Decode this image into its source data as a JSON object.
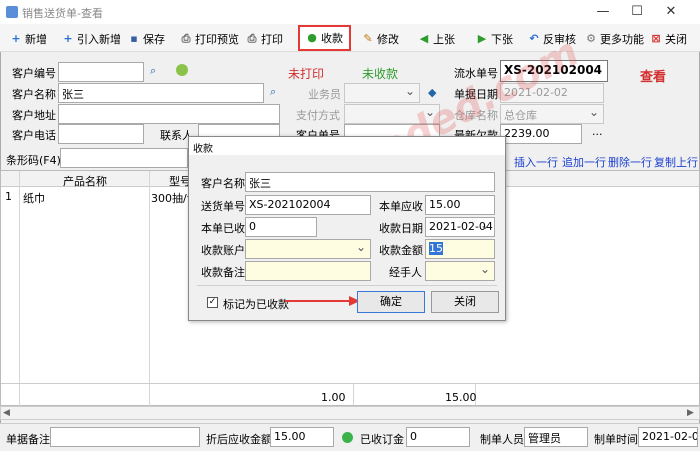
{
  "window": {
    "title": "销售送货单-查看",
    "min": "—",
    "max": "☐",
    "close": "✕"
  },
  "toolbar": {
    "new": "新增",
    "import_new": "引入新增",
    "save": "保存",
    "print_preview": "打印预览",
    "print": "打印",
    "collect": "收款",
    "edit": "修改",
    "prev": "上张",
    "next": "下张",
    "unaudit": "反审核",
    "more": "更多功能",
    "close": "关闭"
  },
  "header": {
    "customer_code_label": "客户编号",
    "customer_code": "",
    "customer_name_label": "客户名称",
    "customer_name": "张三",
    "customer_address_label": "客户地址",
    "customer_address": "",
    "customer_phone_label": "客户电话",
    "customer_phone": "",
    "contact_label": "联系人",
    "print_status": "未打印",
    "collect_status": "未收款",
    "salesman_label": "业务员",
    "payment_label": "支付方式",
    "customer_order_label": "客户单号",
    "serial_label": "流水单号",
    "serial": "XS-202102004",
    "date_label": "单据日期",
    "date": "2021-02-02",
    "warehouse_label": "仓库名称",
    "warehouse": "总仓库",
    "latest_debt_label": "最新欠款",
    "latest_debt": "2239.00",
    "mode_badge": "查看",
    "more_dots": "..."
  },
  "barcode": {
    "label": "条形码(F4)"
  },
  "row_actions": {
    "insert": "插入一行",
    "append": "追加一行",
    "delete": "删除一行",
    "copy": "复制上行"
  },
  "table": {
    "columns": [
      "产品名称",
      "型号"
    ],
    "rows": [
      {
        "no": "1",
        "name": "纸巾",
        "model": "300抽/包"
      }
    ],
    "totals": {
      "qty": "1.00",
      "amount": "15.00"
    }
  },
  "watermark": "www.baoded.com",
  "dialog": {
    "title": "收款",
    "customer_name_label": "客户名称",
    "customer_name": "张三",
    "order_no_label": "送货单号",
    "order_no": "XS-202102004",
    "receivable_label": "本单应收",
    "receivable": "15.00",
    "received_label": "本单已收",
    "received": "0",
    "collect_date_label": "收款日期",
    "collect_date": "2021-02-04",
    "account_label": "收款账户",
    "account": "",
    "amount_label": "收款金额",
    "amount": "15",
    "remark_label": "收款备注",
    "remark": "",
    "handler_label": "经手人",
    "handler": "",
    "mark_collected_label": "标记为已收款",
    "mark_collected": true,
    "ok": "确定",
    "cancel": "关闭"
  },
  "footer": {
    "remark_label": "单据备注",
    "remark": "",
    "discount_total_label": "折后应收金额",
    "discount_total": "15.00",
    "received_label": "已收订金",
    "received": "0",
    "creator_label": "制单人员",
    "creator": "管理员",
    "created_time_label": "制单时间",
    "created_time": "2021-02-02"
  }
}
